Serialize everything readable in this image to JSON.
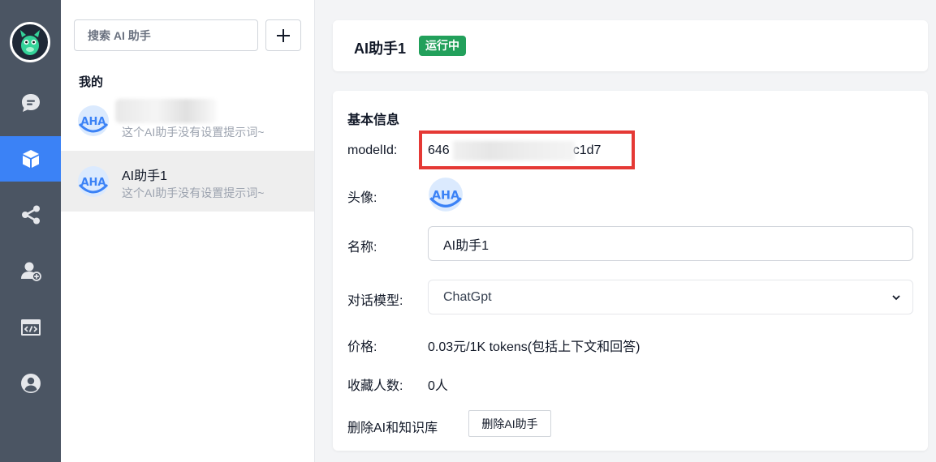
{
  "rail": {
    "items": [
      {
        "icon": "chat-icon",
        "active": false
      },
      {
        "icon": "cube-icon",
        "active": true
      },
      {
        "icon": "share-icon",
        "active": false
      },
      {
        "icon": "add-user-icon",
        "active": false
      },
      {
        "icon": "code-window-icon",
        "active": false
      },
      {
        "icon": "user-icon",
        "active": false
      }
    ],
    "accent_color": "#3b82f6"
  },
  "search": {
    "placeholder": "搜索 AI 助手"
  },
  "list": {
    "group_title": "我的",
    "items": [
      {
        "name": "",
        "desc": "这个AI助手没有设置提示词~",
        "selected": false,
        "name_redacted": true
      },
      {
        "name": "AI助手1",
        "desc": "这个AI助手没有设置提示词~",
        "selected": true
      }
    ]
  },
  "header": {
    "title": "AI助手1",
    "status": "运行中",
    "status_color": "#22a05b"
  },
  "info": {
    "section_title": "基本信息",
    "model_id_label": "modelId:",
    "model_id_prefix": "646",
    "model_id_suffix": "c1d7",
    "avatar_label": "头像:",
    "name_label": "名称:",
    "name_value": "AI助手1",
    "model_label": "对话模型:",
    "model_value": "ChatGpt",
    "price_label": "价格:",
    "price_value": "0.03元/1K tokens(包括上下文和回答)",
    "favorites_label": "收藏人数:",
    "favorites_value": "0人",
    "delete_label": "删除AI和知识库",
    "delete_button": "删除AI助手"
  }
}
